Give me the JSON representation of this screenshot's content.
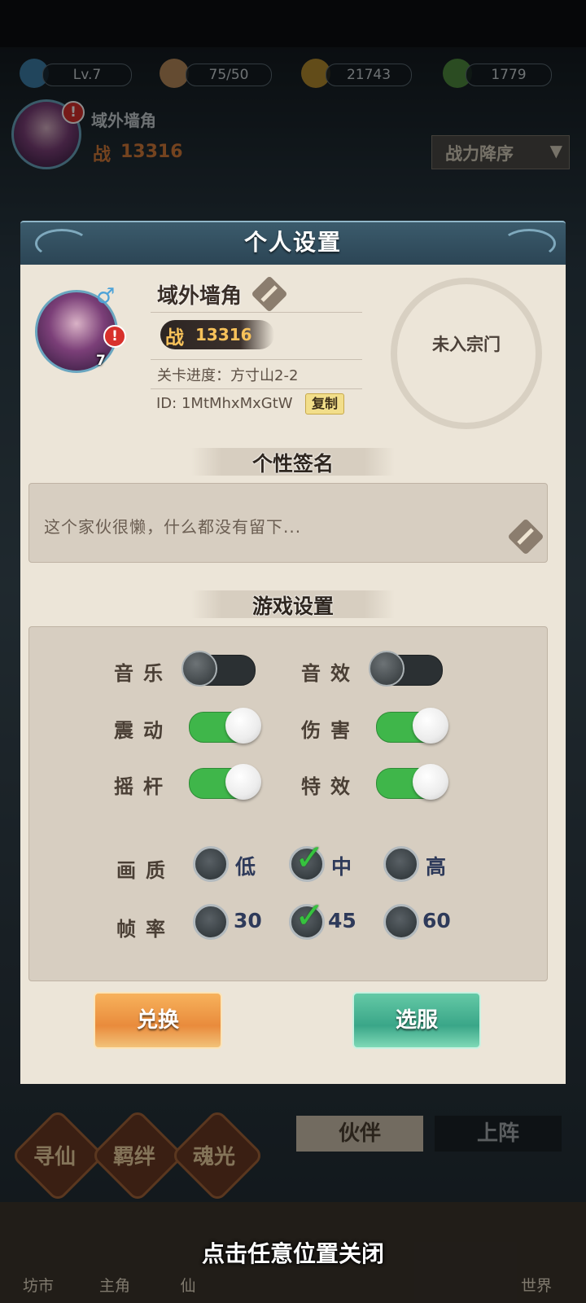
{
  "background": {
    "resources": {
      "level": "Lv.7",
      "stamina": "75/50",
      "coins": "21743",
      "jade": "1779"
    },
    "player": {
      "name": "域外墙角",
      "power_prefix": "战",
      "power": "13316"
    },
    "sort_dropdown": "战力降序",
    "tabs": {
      "partner": "伙伴",
      "deploy": "上阵"
    },
    "circle_buttons": [
      "寻仙",
      "羁绊",
      "魂光"
    ],
    "bottom_nav": [
      "坊市",
      "主角",
      "仙"
    ],
    "bottom_nav_right": "世界"
  },
  "modal": {
    "title": "个人设置",
    "profile": {
      "name": "域外墙角",
      "level": "7",
      "power_prefix": "战",
      "power": "13316",
      "progress": "关卡进度：方寸山2-2",
      "id": "ID: 1MtMhxMxGtW",
      "copy_label": "复制",
      "sect": "未入宗门"
    },
    "signature": {
      "heading": "个性签名",
      "text": "这个家伙很懒，什么都没有留下..."
    },
    "game_settings": {
      "heading": "游戏设置",
      "toggles": [
        {
          "label": "音乐",
          "on": false
        },
        {
          "label": "音效",
          "on": false
        },
        {
          "label": "震动",
          "on": true
        },
        {
          "label": "伤害",
          "on": true
        },
        {
          "label": "摇杆",
          "on": true
        },
        {
          "label": "特效",
          "on": true
        }
      ],
      "quality": {
        "label": "画质",
        "options": [
          "低",
          "中",
          "高"
        ],
        "selected": "中"
      },
      "framerate": {
        "label": "帧率",
        "options": [
          "30",
          "45",
          "60"
        ],
        "selected": "45"
      }
    },
    "buttons": {
      "redeem": "兑换",
      "server": "选服"
    }
  },
  "close_hint": "点击任意位置关闭",
  "colors": {
    "toggle_on": "#3fb64a",
    "check": "#36c33e",
    "orange_btn": "#e98b3c",
    "green_btn": "#3aa688"
  }
}
